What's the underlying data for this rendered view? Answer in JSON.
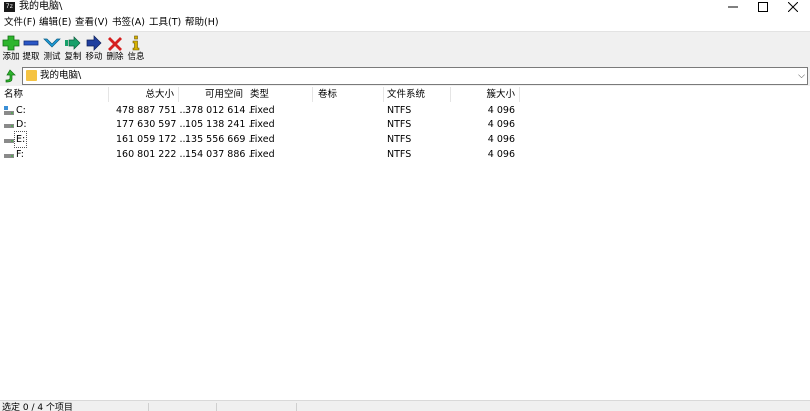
{
  "window": {
    "title": "我的电脑\\"
  },
  "menu": [
    "文件(F)",
    "编辑(E)",
    "查看(V)",
    "书签(A)",
    "工具(T)",
    "帮助(H)"
  ],
  "toolbar": [
    {
      "label": "添加",
      "icon": "add-icon",
      "color": "#2db52d"
    },
    {
      "label": "提取",
      "icon": "extract-icon",
      "color": "#2a56c6"
    },
    {
      "label": "测试",
      "icon": "test-icon",
      "color": "#1e9bd7"
    },
    {
      "label": "复制",
      "icon": "copy-icon",
      "color": "#18a06a"
    },
    {
      "label": "移动",
      "icon": "move-icon",
      "color": "#1f3f9f"
    },
    {
      "label": "删除",
      "icon": "delete-icon",
      "color": "#d51f1f"
    },
    {
      "label": "信息",
      "icon": "info-icon",
      "color": "#d6b000"
    }
  ],
  "address": {
    "path": "我的电脑\\"
  },
  "columns": [
    "名称",
    "总大小",
    "可用空间",
    "类型",
    "卷标",
    "文件系统",
    "簇大小"
  ],
  "rows": [
    {
      "name": "C:",
      "total": "478 887 751 ...",
      "free": "378 012 614 ...",
      "type": "Fixed",
      "label": "",
      "fs": "NTFS",
      "cluster": "4 096"
    },
    {
      "name": "D:",
      "total": "177 630 597 ...",
      "free": "105 138 241 ...",
      "type": "Fixed",
      "label": "",
      "fs": "NTFS",
      "cluster": "4 096"
    },
    {
      "name": "E:",
      "total": "161 059 172 ...",
      "free": "135 556 669 ...",
      "type": "Fixed",
      "label": "",
      "fs": "NTFS",
      "cluster": "4 096"
    },
    {
      "name": "F:",
      "total": "160 801 222 ...",
      "free": "154 037 886 ...",
      "type": "Fixed",
      "label": "",
      "fs": "NTFS",
      "cluster": "4 096"
    }
  ],
  "status": {
    "text": "选定 0 / 4 个项目"
  }
}
